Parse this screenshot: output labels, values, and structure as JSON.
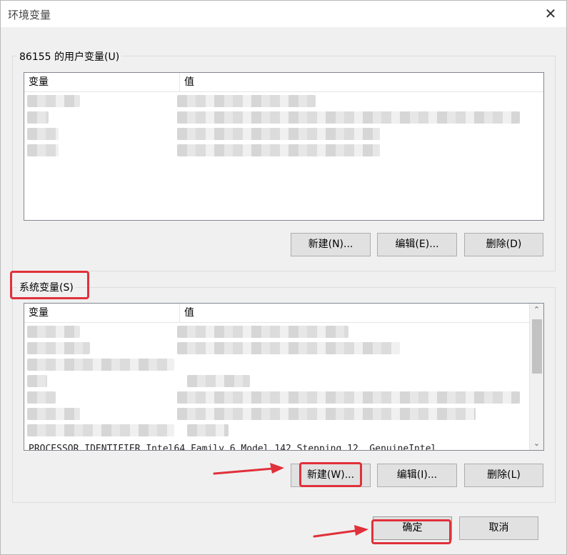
{
  "window": {
    "title": "环境变量",
    "close_icon": "close-icon"
  },
  "user_vars": {
    "group_label": "86155 的用户变量(U)",
    "columns": [
      "变量",
      "值"
    ],
    "buttons": {
      "new": "新建(N)...",
      "edit": "编辑(E)...",
      "delete": "删除(D)"
    }
  },
  "system_vars": {
    "group_label": "系统变量(S)",
    "columns": [
      "变量",
      "值"
    ],
    "last_row": "PROCESSOR_IDENTIFIER          Intel64 Family 6 Model 142 Stepping 12, GenuineIntel",
    "buttons": {
      "new": "新建(W)...",
      "edit": "编辑(I)...",
      "delete": "删除(L)"
    }
  },
  "footer": {
    "ok": "确定",
    "cancel": "取消"
  },
  "colors": {
    "highlight": "#e0313a",
    "dialog_bg": "#f0f0f0",
    "button_bg": "#e1e1e1"
  }
}
